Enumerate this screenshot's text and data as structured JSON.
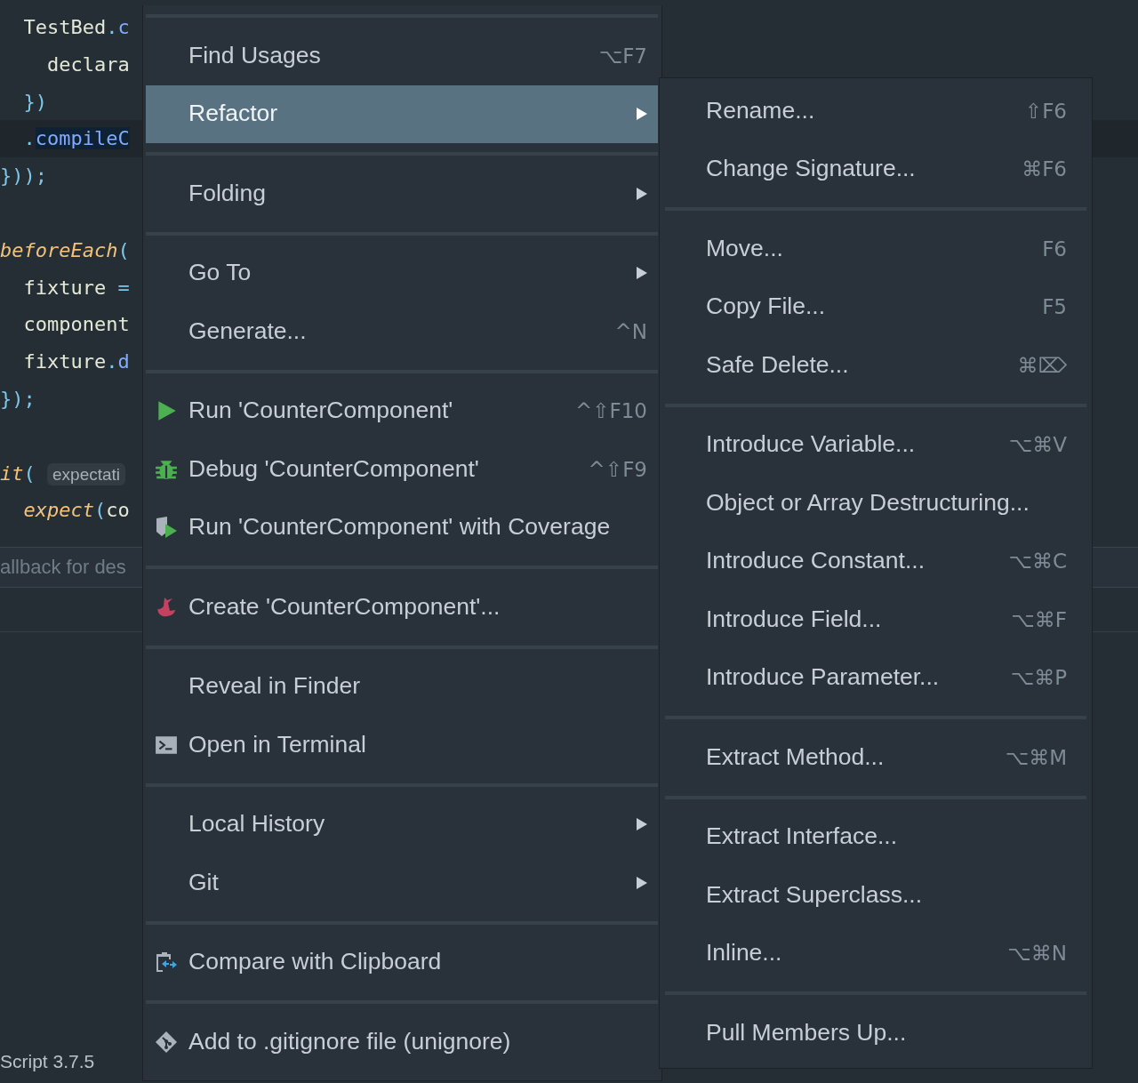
{
  "editor": {
    "lines": [
      {
        "segments": [
          {
            "text": "  TestBed",
            "kind": "plain"
          },
          {
            "text": ".",
            "kind": "punct"
          },
          {
            "text": "c",
            "kind": "method"
          }
        ]
      },
      {
        "segments": [
          {
            "text": "    declara",
            "kind": "plain"
          }
        ]
      },
      {
        "segments": [
          {
            "text": "  })",
            "kind": "punct"
          }
        ]
      },
      {
        "current": true,
        "segments": [
          {
            "text": "  .",
            "kind": "punct"
          },
          {
            "text": "compileC",
            "kind": "selected-method"
          }
        ]
      },
      {
        "segments": [
          {
            "text": "}));",
            "kind": "punct"
          }
        ]
      },
      {
        "blank_before": true,
        "segments": [
          {
            "text": "beforeEach",
            "kind": "keyword"
          },
          {
            "text": "(",
            "kind": "punct"
          }
        ]
      },
      {
        "segments": [
          {
            "text": "  fixture ",
            "kind": "plain"
          },
          {
            "text": "=",
            "kind": "punct"
          }
        ]
      },
      {
        "segments": [
          {
            "text": "  component",
            "kind": "plain"
          }
        ]
      },
      {
        "segments": [
          {
            "text": "  fixture",
            "kind": "plain"
          },
          {
            "text": ".",
            "kind": "punct"
          },
          {
            "text": "d",
            "kind": "method"
          }
        ]
      },
      {
        "segments": [
          {
            "text": "});",
            "kind": "punct"
          }
        ]
      },
      {
        "blank_before": true,
        "segments": [
          {
            "text": "it",
            "kind": "keyword"
          },
          {
            "text": "( ",
            "kind": "punct"
          },
          {
            "text": "expectati",
            "kind": "hint"
          }
        ]
      },
      {
        "segments": [
          {
            "text": "  expect",
            "kind": "keyword"
          },
          {
            "text": "(",
            "kind": "punct"
          },
          {
            "text": "co",
            "kind": "plain"
          }
        ]
      }
    ],
    "breadcrumb": "allback for des",
    "status": "Script 3.7.5"
  },
  "context_menu": {
    "items": [
      {
        "kind": "separator"
      },
      {
        "kind": "item",
        "label": "Find Usages",
        "shortcut": "⌥F7",
        "selected": false
      },
      {
        "kind": "item",
        "label": "Refactor",
        "submenu": true,
        "selected": true
      },
      {
        "kind": "separator"
      },
      {
        "kind": "item",
        "label": "Folding",
        "submenu": true,
        "selected": false
      },
      {
        "kind": "separator"
      },
      {
        "kind": "item",
        "label": "Go To",
        "submenu": true,
        "selected": false
      },
      {
        "kind": "item",
        "label": "Generate...",
        "shortcut": "^N",
        "selected": false
      },
      {
        "kind": "separator"
      },
      {
        "kind": "item",
        "label": "Run 'CounterComponent'",
        "shortcut": "^⇧F10",
        "selected": false
      },
      {
        "kind": "item",
        "label": "Debug 'CounterComponent'",
        "shortcut": "^⇧F9",
        "selected": false
      },
      {
        "kind": "item",
        "label": "Run 'CounterComponent' with Coverage",
        "selected": false
      },
      {
        "kind": "separator"
      },
      {
        "kind": "item",
        "label": "Create 'CounterComponent'...",
        "selected": false
      },
      {
        "kind": "separator"
      },
      {
        "kind": "item",
        "label": "Reveal in Finder",
        "selected": false
      },
      {
        "kind": "item",
        "label": "Open in Terminal",
        "selected": false
      },
      {
        "kind": "separator"
      },
      {
        "kind": "item",
        "label": "Local History",
        "submenu": true,
        "selected": false
      },
      {
        "kind": "item",
        "label": "Git",
        "submenu": true,
        "selected": false
      },
      {
        "kind": "separator"
      },
      {
        "kind": "item",
        "label": "Compare with Clipboard",
        "selected": false
      },
      {
        "kind": "separator"
      },
      {
        "kind": "item",
        "label": "Add to .gitignore file (unignore)",
        "selected": false
      }
    ]
  },
  "refactor_submenu": {
    "items": [
      {
        "kind": "item",
        "label": "Rename...",
        "shortcut": "⇧F6"
      },
      {
        "kind": "item",
        "label": "Change Signature...",
        "shortcut": "⌘F6"
      },
      {
        "kind": "separator"
      },
      {
        "kind": "item",
        "label": "Move...",
        "shortcut": "F6"
      },
      {
        "kind": "item",
        "label": "Copy File...",
        "shortcut": "F5"
      },
      {
        "kind": "item",
        "label": "Safe Delete...",
        "shortcut": "⌘⌦"
      },
      {
        "kind": "separator"
      },
      {
        "kind": "item",
        "label": "Introduce Variable...",
        "shortcut": "⌥⌘V"
      },
      {
        "kind": "item",
        "label": "Object or Array Destructuring..."
      },
      {
        "kind": "item",
        "label": "Introduce Constant...",
        "shortcut": "⌥⌘C"
      },
      {
        "kind": "item",
        "label": "Introduce Field...",
        "shortcut": "⌥⌘F"
      },
      {
        "kind": "item",
        "label": "Introduce Parameter...",
        "shortcut": "⌥⌘P"
      },
      {
        "kind": "separator"
      },
      {
        "kind": "item",
        "label": "Extract Method...",
        "shortcut": "⌥⌘M"
      },
      {
        "kind": "separator"
      },
      {
        "kind": "item",
        "label": "Extract Interface..."
      },
      {
        "kind": "item",
        "label": "Extract Superclass..."
      },
      {
        "kind": "item",
        "label": "Inline...",
        "shortcut": "⌥⌘N"
      },
      {
        "kind": "separator"
      },
      {
        "kind": "item",
        "label": "Pull Members Up..."
      }
    ]
  }
}
